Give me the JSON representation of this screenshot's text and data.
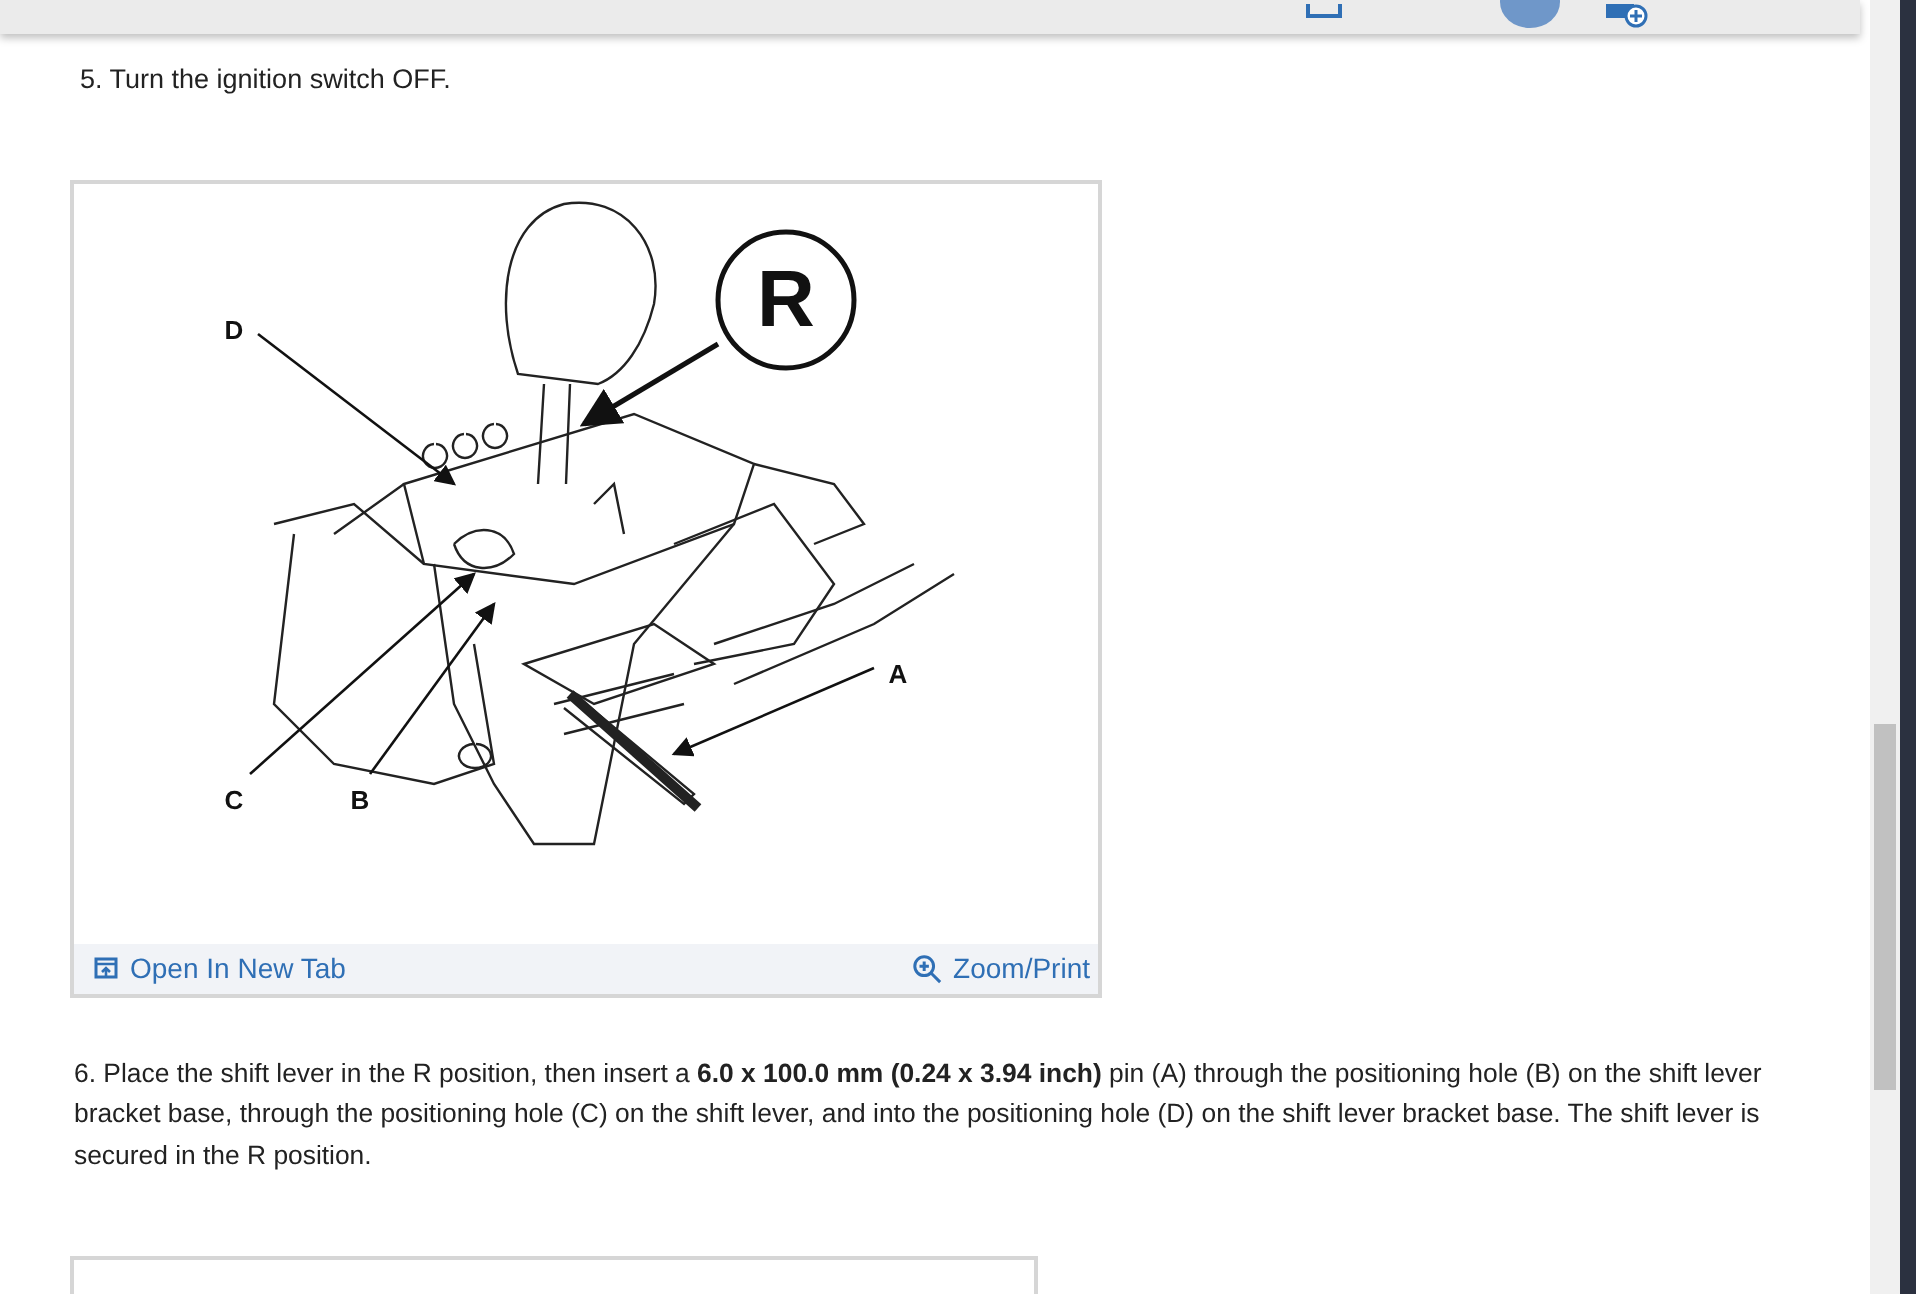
{
  "steps_before": [
    {
      "text": "5. Turn the ignition switch OFF."
    }
  ],
  "figure": {
    "callouts": [
      {
        "label": "R",
        "kind": "circled"
      },
      {
        "label": "D",
        "kind": "plain"
      },
      {
        "label": "A",
        "kind": "plain"
      },
      {
        "label": "C",
        "kind": "plain"
      },
      {
        "label": "B",
        "kind": "plain"
      }
    ],
    "open_link": "Open In New Tab",
    "zoom_link": "Zoom/Print"
  },
  "steps_after": [
    {
      "text": "6. Place the shift lever in the R position, then insert a **6.0 x 100.0 mm (0.24 x 3.94 inch)** pin (A) through the positioning hole (B) on the shift lever bracket base, through the positioning hole (C) on the shift lever, and into the positioning hole (D) on the shift lever bracket base. The shift lever is secured in the R position."
    }
  ]
}
